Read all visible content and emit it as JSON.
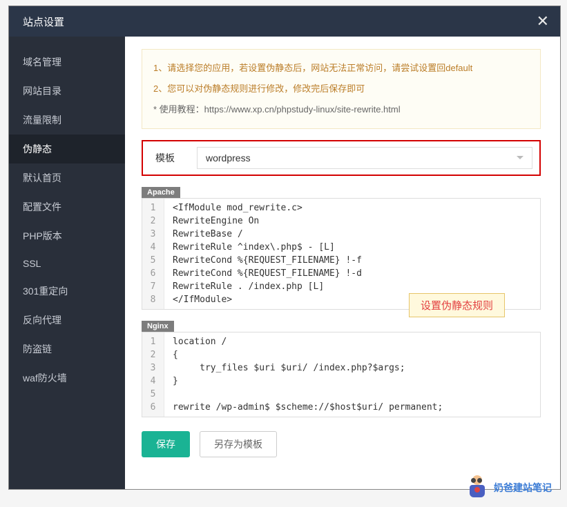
{
  "header": {
    "title": "站点设置"
  },
  "sidebar": {
    "items": [
      {
        "label": "域名管理",
        "active": false
      },
      {
        "label": "网站目录",
        "active": false
      },
      {
        "label": "流量限制",
        "active": false
      },
      {
        "label": "伪静态",
        "active": true
      },
      {
        "label": "默认首页",
        "active": false
      },
      {
        "label": "配置文件",
        "active": false
      },
      {
        "label": "PHP版本",
        "active": false
      },
      {
        "label": "SSL",
        "active": false
      },
      {
        "label": "301重定向",
        "active": false
      },
      {
        "label": "反向代理",
        "active": false
      },
      {
        "label": "防盗链",
        "active": false
      },
      {
        "label": "waf防火墙",
        "active": false
      }
    ]
  },
  "info": {
    "line1": "1、请选择您的应用，若设置伪静态后，网站无法正常访问，请尝试设置回default",
    "line2": "2、您可以对伪静态规则进行修改，修改完后保存即可",
    "line3_prefix": "* 使用教程：",
    "line3_url": "https://www.xp.cn/phpstudy-linux/site-rewrite.html"
  },
  "template": {
    "label": "模板",
    "selected": "wordpress"
  },
  "apache": {
    "label": "Apache",
    "lines": [
      "<IfModule mod_rewrite.c>",
      "RewriteEngine On",
      "RewriteBase /",
      "RewriteRule ^index\\.php$ - [L]",
      "RewriteCond %{REQUEST_FILENAME} !-f",
      "RewriteCond %{REQUEST_FILENAME} !-d",
      "RewriteRule . /index.php [L]",
      "</IfModule>"
    ]
  },
  "nginx": {
    "label": "Nginx",
    "lines": [
      "location /",
      "{",
      "     try_files $uri $uri/ /index.php?$args;",
      "}",
      "",
      "rewrite /wp-admin$ $scheme://$host$uri/ permanent;"
    ]
  },
  "annotation": "设置伪静态规则",
  "buttons": {
    "save": "保存",
    "save_as_template": "另存为模板"
  },
  "watermark": "奶爸建站笔记"
}
